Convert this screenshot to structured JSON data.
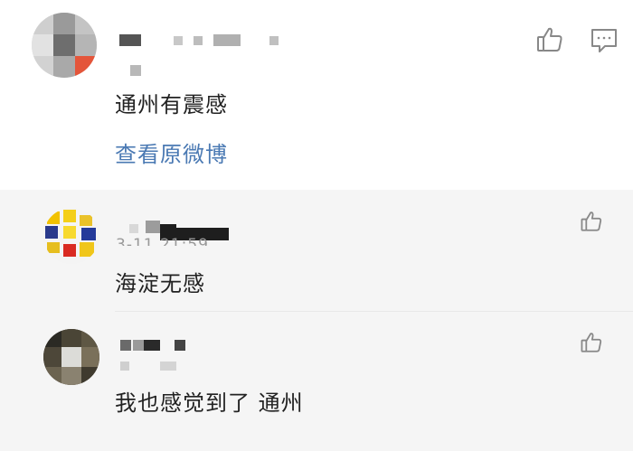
{
  "main": {
    "comment_text": "通州有震感",
    "view_original_label": "查看原微博",
    "like_icon": "thumbs-up-icon",
    "comment_icon": "comment-icon"
  },
  "replies": [
    {
      "comment_text": "海淀无感",
      "timestamp_partial": "3-11 21:59",
      "like_icon": "thumbs-up-icon"
    },
    {
      "comment_text": "我也感觉到了 通州",
      "like_icon": "thumbs-up-icon"
    }
  ],
  "colors": {
    "text": "#222222",
    "link": "#4a79b3",
    "icon": "#888888",
    "reply_background": "#f5f5f5"
  }
}
